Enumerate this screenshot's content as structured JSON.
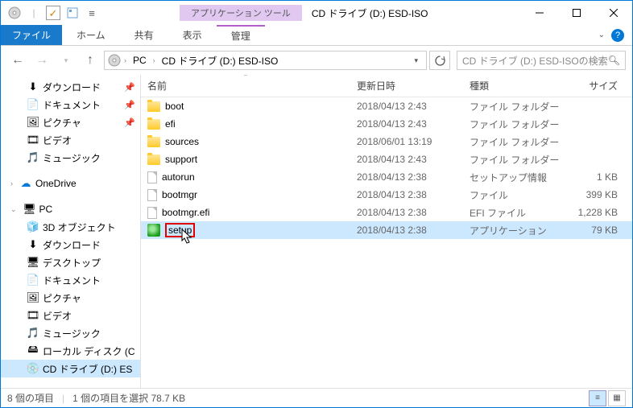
{
  "title_bar": {
    "tools_tab": "アプリケーション ツール",
    "title": "CD ドライブ (D:) ESD-ISO"
  },
  "ribbon": {
    "file": "ファイル",
    "home": "ホーム",
    "share": "共有",
    "view": "表示",
    "manage": "管理"
  },
  "breadcrumb": {
    "pc": "PC",
    "drive": "CD ドライブ (D:) ESD-ISO"
  },
  "search": {
    "placeholder": "CD ドライブ (D:) ESD-ISOの検索"
  },
  "nav": {
    "downloads": "ダウンロード",
    "documents": "ドキュメント",
    "pictures": "ピクチャ",
    "videos": "ビデオ",
    "music": "ミュージック",
    "onedrive": "OneDrive",
    "pc": "PC",
    "objects3d": "3D オブジェクト",
    "downloads2": "ダウンロード",
    "desktop": "デスクトップ",
    "documents2": "ドキュメント",
    "pictures2": "ピクチャ",
    "videos2": "ビデオ",
    "music2": "ミュージック",
    "localdisk": "ローカル ディスク (C",
    "cddrive": "CD ドライブ (D:) ES"
  },
  "columns": {
    "name": "名前",
    "date": "更新日時",
    "type": "種類",
    "size": "サイズ"
  },
  "files": [
    {
      "icon": "folder",
      "name": "boot",
      "date": "2018/04/13 2:43",
      "type": "ファイル フォルダー",
      "size": "",
      "selected": false
    },
    {
      "icon": "folder",
      "name": "efi",
      "date": "2018/04/13 2:43",
      "type": "ファイル フォルダー",
      "size": "",
      "selected": false
    },
    {
      "icon": "folder",
      "name": "sources",
      "date": "2018/06/01 13:19",
      "type": "ファイル フォルダー",
      "size": "",
      "selected": false
    },
    {
      "icon": "folder",
      "name": "support",
      "date": "2018/04/13 2:43",
      "type": "ファイル フォルダー",
      "size": "",
      "selected": false
    },
    {
      "icon": "file",
      "name": "autorun",
      "date": "2018/04/13 2:38",
      "type": "セットアップ情報",
      "size": "1 KB",
      "selected": false
    },
    {
      "icon": "file",
      "name": "bootmgr",
      "date": "2018/04/13 2:38",
      "type": "ファイル",
      "size": "399 KB",
      "selected": false
    },
    {
      "icon": "file",
      "name": "bootmgr.efi",
      "date": "2018/04/13 2:38",
      "type": "EFI ファイル",
      "size": "1,228 KB",
      "selected": false
    },
    {
      "icon": "setup",
      "name": "setup",
      "date": "2018/04/13 2:38",
      "type": "アプリケーション",
      "size": "79 KB",
      "selected": true,
      "highlight": true
    }
  ],
  "status": {
    "count": "8 個の項目",
    "selection": "1 個の項目を選択 78.7 KB"
  }
}
